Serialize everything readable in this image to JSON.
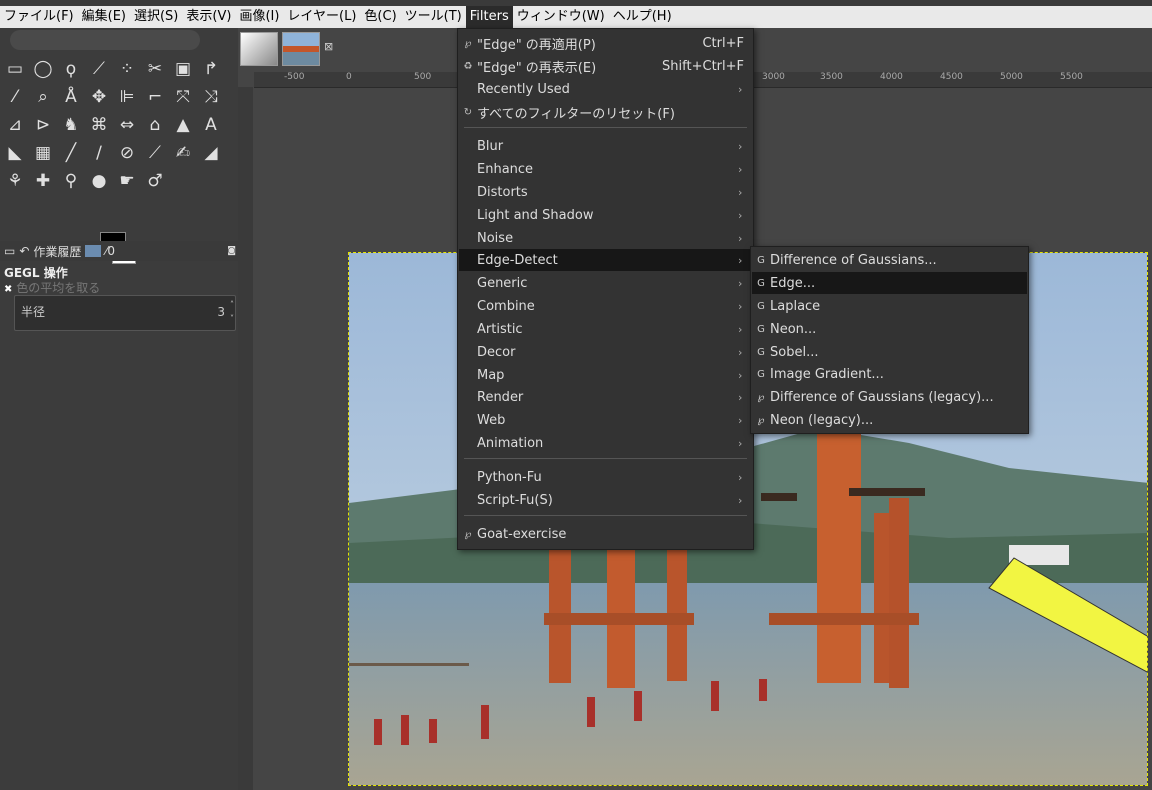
{
  "menubar": {
    "items": [
      "ファイル(F)",
      "編集(E)",
      "選択(S)",
      "表示(V)",
      "画像(I)",
      "レイヤー(L)",
      "色(C)",
      "ツール(T)",
      "Filters",
      "ウィンドウ(W)",
      "ヘルプ(H)"
    ],
    "active": "Filters"
  },
  "dock": {
    "history_tab": "作業履歴",
    "gegl_title": "GEGL 操作",
    "gegl_subtitle": "色の平均を取る",
    "radius_label": "半径",
    "radius_value": "3"
  },
  "ruler": {
    "ticks": [
      "-500",
      "0",
      "500",
      "3000",
      "3500",
      "4000",
      "4500",
      "5000",
      "5500"
    ]
  },
  "filters_menu": {
    "reapply": {
      "label": "\"Edge\" の再適用(P)",
      "shortcut": "Ctrl+F"
    },
    "reshow": {
      "label": "\"Edge\" の再表示(E)",
      "shortcut": "Shift+Ctrl+F"
    },
    "recently_used": "Recently Used",
    "reset_all": "すべてのフィルターのリセット(F)",
    "groups": [
      "Blur",
      "Enhance",
      "Distorts",
      "Light and Shadow",
      "Noise",
      "Edge-Detect",
      "Generic",
      "Combine",
      "Artistic",
      "Decor",
      "Map",
      "Render",
      "Web",
      "Animation"
    ],
    "scripts": [
      "Python-Fu",
      "Script-Fu(S)"
    ],
    "goat": "Goat-exercise"
  },
  "edge_detect_menu": {
    "items": [
      "Difference of Gaussians...",
      "Edge...",
      "Laplace",
      "Neon...",
      "Sobel...",
      "Image Gradient...",
      "Difference of Gaussians (legacy)...",
      "Neon (legacy)..."
    ],
    "highlighted": "Edge..."
  },
  "colors": {
    "menu_bg": "#333333",
    "highlight": "#171717",
    "selection_border": "#e5e500",
    "annotation_arrow": "#f2f542"
  }
}
